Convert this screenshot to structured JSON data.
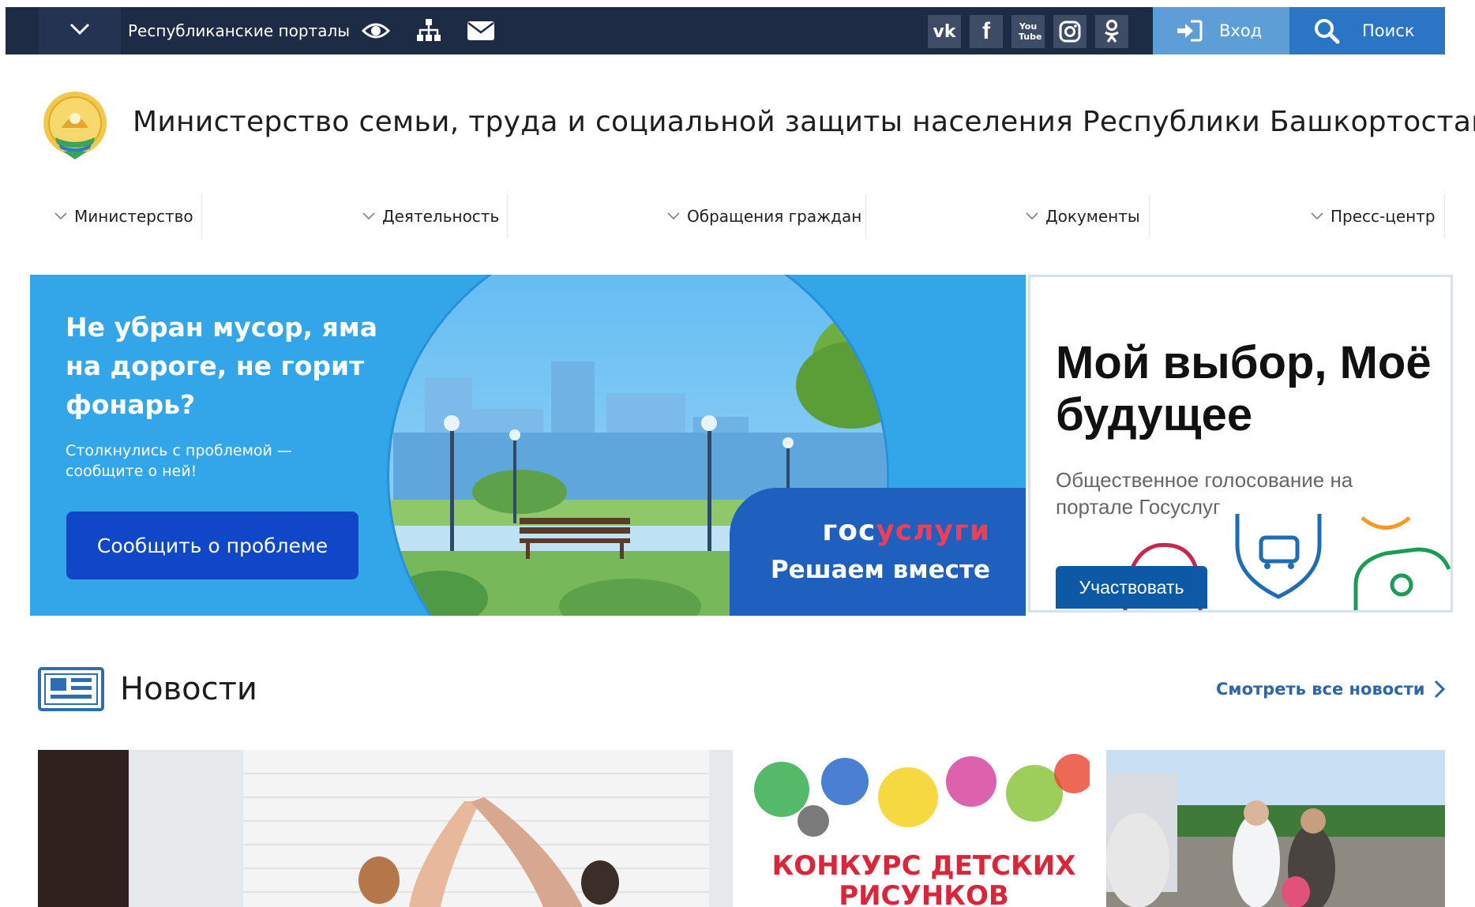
{
  "topbar": {
    "menu_toggle_icon": "chevron-down-icon",
    "portals_label": "Республиканские порталы",
    "accessibility_icon": "eye-icon",
    "sitemap_icon": "sitemap-icon",
    "mail_icon": "envelope-icon",
    "social": [
      {
        "name": "vk-icon",
        "glyph": "vk"
      },
      {
        "name": "facebook-icon",
        "glyph": "f"
      },
      {
        "name": "youtube-icon",
        "glyph": "You Tube"
      },
      {
        "name": "instagram-icon",
        "glyph": ""
      },
      {
        "name": "odnoklassniki-icon",
        "glyph": ""
      }
    ],
    "login_label": "Вход",
    "search_label": "Поиск",
    "colors": {
      "bar": "#1e2b45",
      "login": "#5e9ed6",
      "search": "#2c75c4"
    }
  },
  "header": {
    "emblem": "bashkortostan-emblem",
    "title": "Министерство семьи, труда и социальной защиты населения Республики Башкортостан"
  },
  "nav": {
    "items": [
      {
        "label": "Министерство"
      },
      {
        "label": "Деятельность"
      },
      {
        "label": "Обращения граждан"
      },
      {
        "label": "Документы"
      },
      {
        "label": "Пресс-центр"
      }
    ]
  },
  "banner_problem": {
    "headline": "Не убран мусор, яма на дороге, не горит фонарь?",
    "subtext": "Столкнулись с проблемой — сообщите о ней!",
    "button_label": "Сообщить о проблеме",
    "logo_part1": "гос",
    "logo_part2": "услуги",
    "tagline": "Решаем вместе",
    "colors": {
      "bg": "#33a6ea",
      "button": "#0f47c8",
      "logo_accent": "#ee3f58"
    }
  },
  "banner_vote": {
    "title": "Мой выбор, Моё будущее",
    "subtitle": "Общественное голосование на портале Госуслуг",
    "button_label": "Участвовать",
    "colors": {
      "button": "#0d59a6"
    }
  },
  "news": {
    "icon": "newspaper-icon",
    "title": "Новости",
    "see_all_label": "Смотреть все новости",
    "see_all_icon": "chevron-right-icon",
    "cards": [
      {
        "image": "family-hands-house-photo"
      },
      {
        "image": "children-drawing-contest-poster",
        "overlay_text": "КОНКУРС ДЕТСКИХ РИСУНКОВ"
      },
      {
        "image": "medical-outdoor-photo"
      }
    ]
  }
}
